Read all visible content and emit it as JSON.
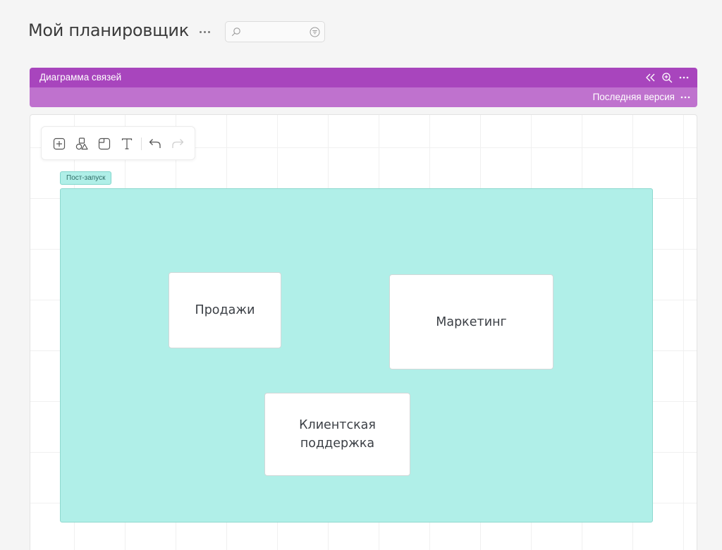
{
  "page": {
    "title": "Мой планировщик"
  },
  "search": {
    "value": "",
    "placeholder": ""
  },
  "panel": {
    "title": "Диаграмма связей",
    "version_label": "Последняя версия",
    "header_color": "#a845bd",
    "subheader_color": "#bf72ce"
  },
  "canvas": {
    "toolbar": [
      "add-node-icon",
      "shapes-icon",
      "sticky-note-icon",
      "text-icon",
      "undo-icon",
      "redo-icon"
    ],
    "frame": {
      "label": "Пост-запуск",
      "color": "#b0efe8"
    },
    "nodes": [
      {
        "text": "Продажи"
      },
      {
        "text": "Маркетинг"
      },
      {
        "text": "Клиентская поддержка"
      }
    ]
  }
}
